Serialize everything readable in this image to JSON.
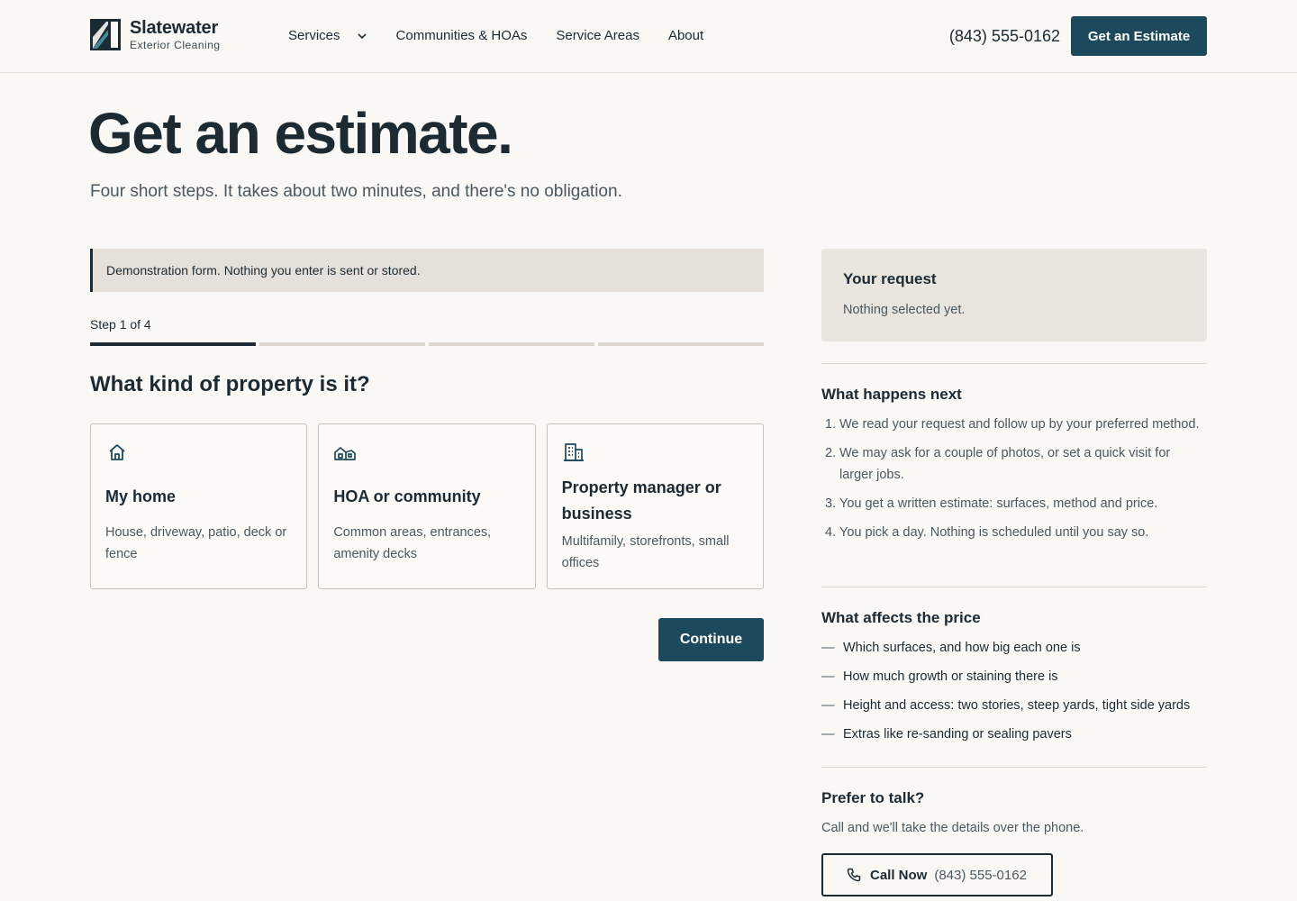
{
  "brand": {
    "name": "Slatewater",
    "tagline": "Exterior Cleaning"
  },
  "nav": {
    "items": [
      {
        "label": "Services",
        "has_dropdown": true
      },
      {
        "label": "Communities & HOAs"
      },
      {
        "label": "Service Areas"
      },
      {
        "label": "About"
      }
    ],
    "phone": "(843) 555-0162",
    "cta": "Get an Estimate"
  },
  "hero": {
    "title": "Get an estimate.",
    "subtitle": "Four short steps. It takes about two minutes, and there's no obligation."
  },
  "form": {
    "notice": "Demonstration form. Nothing you enter is sent or stored.",
    "step_label": "Step 1 of 4",
    "progress": {
      "current": 1,
      "total": 4
    },
    "question": "What kind of property is it?",
    "options": [
      {
        "icon": "house-icon",
        "title": "My home",
        "description": "House, driveway, patio, deck or fence"
      },
      {
        "icon": "community-icon",
        "title": "HOA or community",
        "description": "Common areas, entrances, amenity decks"
      },
      {
        "icon": "building-icon",
        "title": "Property manager or business",
        "description": "Multifamily, storefronts, small offices"
      }
    ],
    "continue_label": "Continue"
  },
  "sidebar": {
    "summary": {
      "title": "Your request",
      "empty": "Nothing selected yet."
    },
    "next": {
      "title": "What happens next",
      "steps": [
        "We read your request and follow up by your preferred method.",
        "We may ask for a couple of photos, or set a quick visit for larger jobs.",
        "You get a written estimate: surfaces, method and price.",
        "You pick a day. Nothing is scheduled until you say so."
      ]
    },
    "price": {
      "title": "What affects the price",
      "items": [
        "Which surfaces, and how big each one is",
        "How much growth or staining there is",
        "Height and access: two stories, steep yards, tight side yards",
        "Extras like re-sanding or sealing pavers"
      ]
    },
    "talk": {
      "title": "Prefer to talk?",
      "text": "Call and we'll take the details over the phone.",
      "call_label": "Call Now",
      "call_number": "(843) 555-0162"
    }
  },
  "colors": {
    "accent": "#1c4a5c",
    "ink": "#1b2a33",
    "background": "#f9f8f5",
    "muted": "#4a5860"
  }
}
